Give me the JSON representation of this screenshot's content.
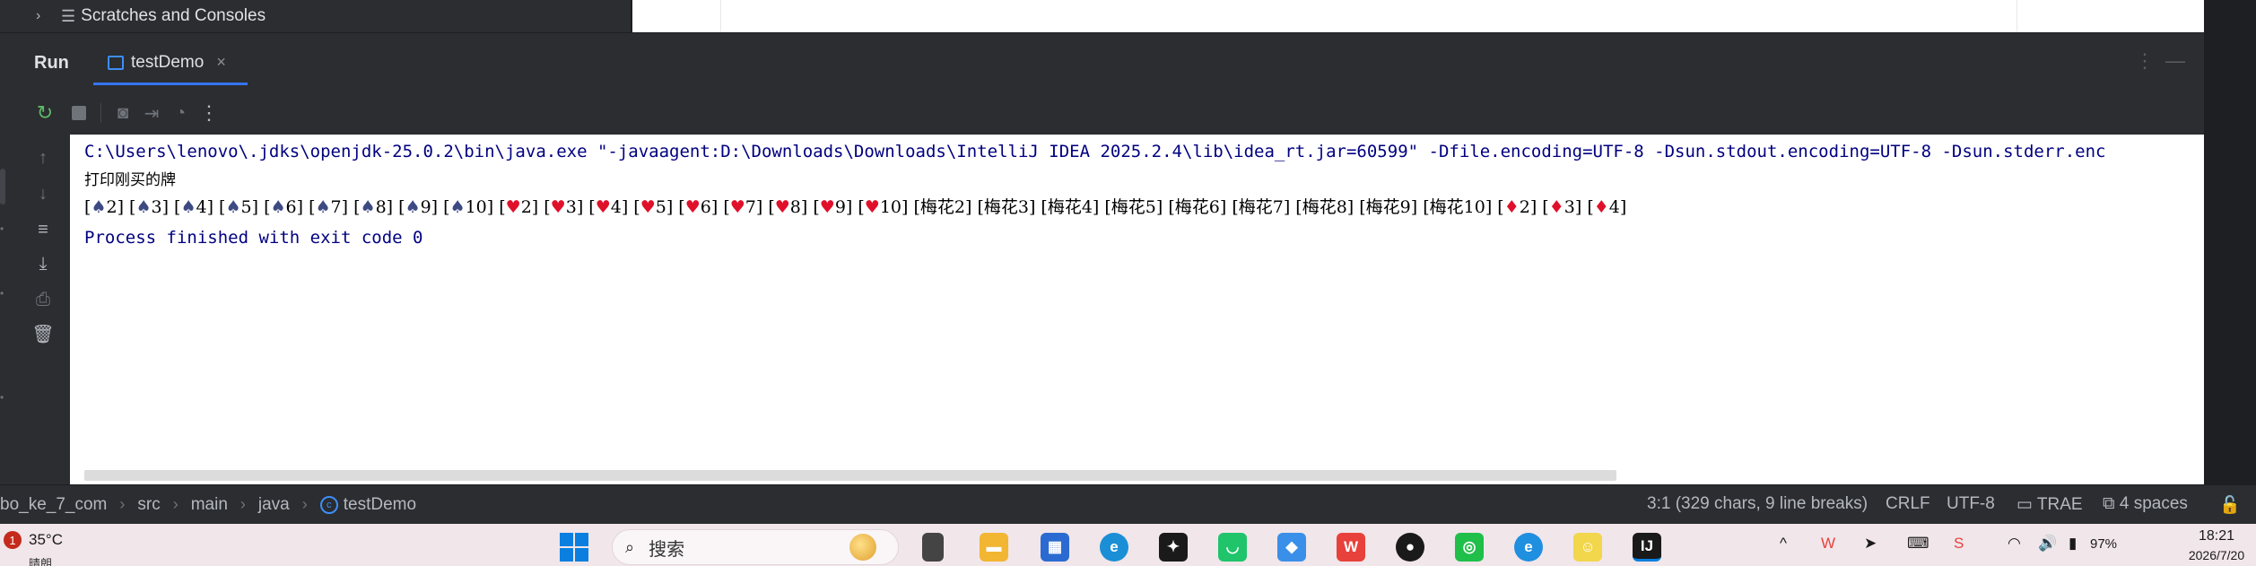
{
  "project_panel": {
    "scratches_label": "Scratches and Consoles"
  },
  "run_window": {
    "title": "Run",
    "tab_label": "testDemo",
    "tab_close": "×",
    "header_icons": [
      "more-vertical-icon",
      "minimize-icon"
    ]
  },
  "toolbar": {
    "icons": [
      "rerun-icon",
      "stop-icon",
      "camera-icon",
      "export-icon",
      "dashboard-icon",
      "more-icon"
    ]
  },
  "side_toolbar": {
    "icons": [
      "up-arrow-icon",
      "down-arrow-icon",
      "soft-wrap-icon",
      "scroll-to-end-icon",
      "print-icon",
      "trash-icon"
    ]
  },
  "console": {
    "command_line": "C:\\Users\\lenovo\\.jdks\\openjdk-25.0.2\\bin\\java.exe \"-javaagent:D:\\Downloads\\Downloads\\IntelliJ IDEA 2025.2.4\\lib\\idea_rt.jar=60599\" -Dfile.encoding=UTF-8 -Dsun.stdout.encoding=UTF-8 -Dsun.stderr.enc",
    "output_label": "打印刚买的牌",
    "cards": [
      {
        "suit": "spade",
        "rank": "2"
      },
      {
        "suit": "spade",
        "rank": "3"
      },
      {
        "suit": "spade",
        "rank": "4"
      },
      {
        "suit": "spade",
        "rank": "5"
      },
      {
        "suit": "spade",
        "rank": "6"
      },
      {
        "suit": "spade",
        "rank": "7"
      },
      {
        "suit": "spade",
        "rank": "8"
      },
      {
        "suit": "spade",
        "rank": "9"
      },
      {
        "suit": "spade",
        "rank": "10"
      },
      {
        "suit": "heart",
        "rank": "2"
      },
      {
        "suit": "heart",
        "rank": "3"
      },
      {
        "suit": "heart",
        "rank": "4"
      },
      {
        "suit": "heart",
        "rank": "5"
      },
      {
        "suit": "heart",
        "rank": "6"
      },
      {
        "suit": "heart",
        "rank": "7"
      },
      {
        "suit": "heart",
        "rank": "8"
      },
      {
        "suit": "heart",
        "rank": "9"
      },
      {
        "suit": "heart",
        "rank": "10"
      },
      {
        "suit": "text",
        "rank": "梅花2"
      },
      {
        "suit": "text",
        "rank": "梅花3"
      },
      {
        "suit": "text",
        "rank": "梅花4"
      },
      {
        "suit": "text",
        "rank": "梅花5"
      },
      {
        "suit": "text",
        "rank": "梅花6"
      },
      {
        "suit": "text",
        "rank": "梅花7"
      },
      {
        "suit": "text",
        "rank": "梅花8"
      },
      {
        "suit": "text",
        "rank": "梅花9"
      },
      {
        "suit": "text",
        "rank": "梅花10"
      },
      {
        "suit": "diamond",
        "rank": "2"
      },
      {
        "suit": "diamond",
        "rank": "3"
      },
      {
        "suit": "diamond",
        "rank": "4"
      }
    ],
    "exit_message": "Process finished with exit code 0"
  },
  "statusbar": {
    "breadcrumbs": [
      "bo_ke_7_com",
      "src",
      "main",
      "java",
      "testDemo"
    ],
    "position_info": "3:1 (329 chars, 9 line breaks)",
    "line_separator": "CRLF",
    "encoding": "UTF-8",
    "plugin_label": "TRAE",
    "indent": "4 spaces"
  },
  "taskbar": {
    "weather_temp": "35°C",
    "weather_sub": "晴朗",
    "notification_count": "1",
    "search_placeholder": "搜索",
    "battery": "97%",
    "time": "18:21",
    "date": "2026/7/20"
  },
  "colors": {
    "ide_bg": "#2b2d30",
    "console_bg": "#ffffff",
    "command_text": "#000080",
    "heart_red": "#e0102a",
    "accent_blue": "#3574f0"
  }
}
